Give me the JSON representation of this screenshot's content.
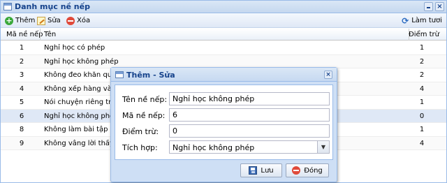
{
  "window": {
    "title": "Danh mục nề nếp",
    "minimize_icon": "minimize-icon",
    "close_icon": "close-icon"
  },
  "toolbar": {
    "add_label": "Thêm",
    "edit_label": "Sửa",
    "delete_label": "Xóa",
    "refresh_label": "Làm tươi"
  },
  "grid": {
    "columns": [
      "Mã nề nếp",
      "Tên",
      "Điểm trừ"
    ],
    "rows": [
      {
        "code": "1",
        "name": "Nghỉ học có phép",
        "points": "1"
      },
      {
        "code": "2",
        "name": "Nghỉ học không phép",
        "points": "2"
      },
      {
        "code": "3",
        "name": "Không đeo khăn quàng đ",
        "points": "2"
      },
      {
        "code": "4",
        "name": "Không xếp hàng vào lớp",
        "points": "4"
      },
      {
        "code": "5",
        "name": "Nói chuyện riêng trong g",
        "points": "1"
      },
      {
        "code": "6",
        "name": "Nghỉ học không phép",
        "points": "0"
      },
      {
        "code": "8",
        "name": "Không làm bài tập về nhà",
        "points": "1"
      },
      {
        "code": "9",
        "name": "Không vâng lời thầy cô",
        "points": "4"
      }
    ],
    "selected_index": 5
  },
  "dialog": {
    "title": "Thêm - Sửa",
    "fields": {
      "name_label": "Tên nề nếp:",
      "name_value": "Nghỉ học không phép",
      "code_label": "Mã nề nếp:",
      "code_value": "6",
      "points_label": "Điểm trừ:",
      "points_value": "0",
      "integrate_label": "Tích hợp:",
      "integrate_value": "Nghỉ học không phép"
    },
    "save_label": "Lưu",
    "close_label": "Đóng"
  },
  "colors": {
    "header": "#15428b",
    "border": "#99bbe8",
    "selected_row": "#dfe8f6",
    "dialog_bg": "#cedff5"
  }
}
